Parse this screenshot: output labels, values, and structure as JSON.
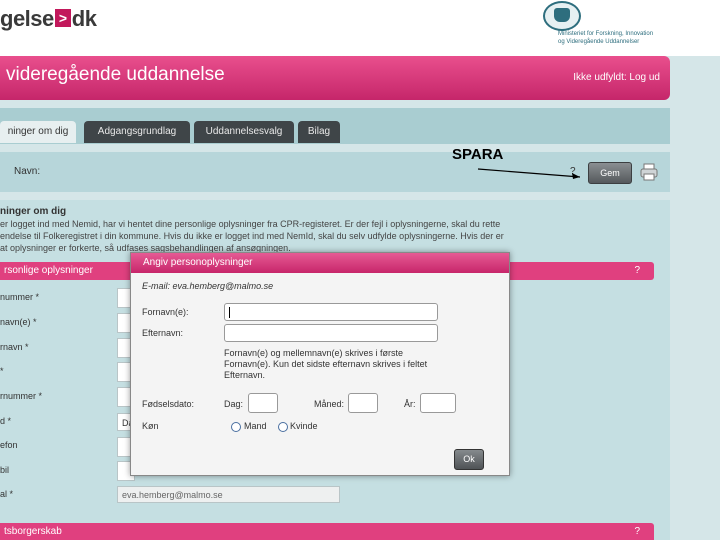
{
  "header": {
    "logo_text_1": "gelse",
    "logo_arrow": ">",
    "logo_text_2": "dk",
    "ministry_lines": [
      "Ministeriet for Forskning, Innovation",
      "og Videregående Uddannelser"
    ]
  },
  "titlebar": {
    "title": "videregående uddannelse",
    "user_status": "Ikke udfyldt: Log ud"
  },
  "tabs": [
    {
      "label": "ninger om dig",
      "active": true
    },
    {
      "label": "Adgangsgrundlag",
      "active": false
    },
    {
      "label": "Uddannelsesvalg",
      "active": false
    },
    {
      "label": "Bilag",
      "active": false
    }
  ],
  "namebar": {
    "label": "Navn:",
    "help": "?",
    "save_label": "Gem"
  },
  "annotation": {
    "text": "SPARA"
  },
  "content": {
    "section_title": "ninger om dig",
    "intro_lines": [
      "er logget ind med Nemid, har vi hentet dine personlige oplysninger fra CPR-registeret. Er der fejl i oplysningerne, skal du rette",
      "endelse til Folkeregistret i din kommune. Hvis du ikke er logget ind med NemId, skal du selv udfylde oplysningerne. Hvis der er",
      "at oplysninger er forkerte, så udfases sagsbehandlingen af ansøgningen."
    ],
    "personal_bar": "rsonlige oplysninger",
    "personal_help": "?",
    "form_labels": [
      "nummer *",
      "navn(e) *",
      "rnavn *",
      "*",
      "rnummer *",
      "d *",
      "efon",
      "bil",
      "al *"
    ],
    "da_value": "Da",
    "email_value": "eva.hemberg@malmo.se",
    "citizenship_bar": "tsborgerskab",
    "citizenship_help": "?"
  },
  "modal": {
    "title": "Angiv personoplysninger",
    "email_line": "E-mail: eva.hemberg@malmo.se",
    "firstname_label": "Fornavn(e):",
    "lastname_label": "Efternavn:",
    "hint_lines": [
      "Fornavn(e) og mellemnavn(e) skrives i første",
      "Fornavn(e). Kun det sidste efternavn skrives i feltet",
      "Efternavn."
    ],
    "birthdate_label": "Fødselsdato:",
    "day_label": "Dag:",
    "month_label": "Måned:",
    "year_label": "År:",
    "gender_label": "Køn",
    "gender_male": "Mand",
    "gender_female": "Kvinde",
    "ok_label": "Ok"
  },
  "colors": {
    "pink": "#e0407f",
    "teal": "#c5dfe2",
    "tab_dark": "#3f4548"
  }
}
